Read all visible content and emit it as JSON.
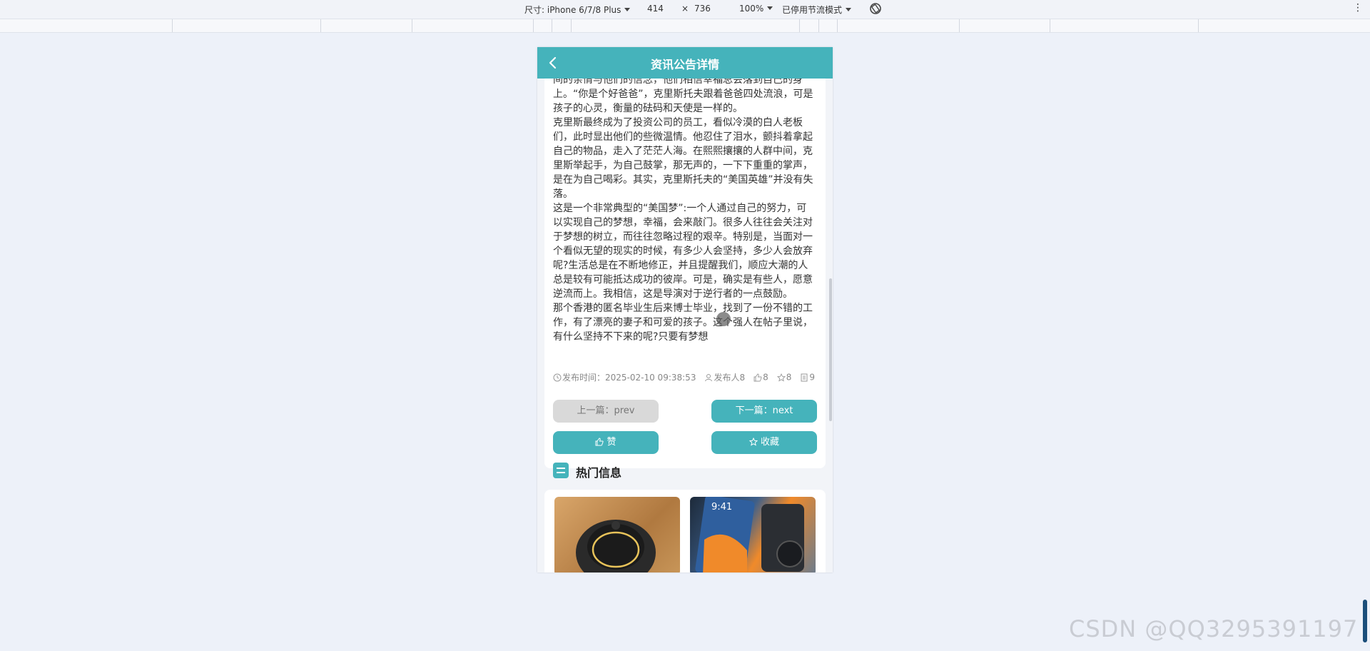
{
  "devtools": {
    "size_label": "尺寸: iPhone 6/7/8 Plus",
    "width": "414",
    "times": "×",
    "height": "736",
    "zoom": "100%",
    "throttle": "已停用节流模式",
    "more": "⋮"
  },
  "header": {
    "title": "资讯公告详情"
  },
  "article": {
    "paragraphs": [
      "间的亲情与他们的信念，他们相信幸福总会落到自己的身上。“你是个好爸爸”，克里斯托夫跟着爸爸四处流浪，可是孩子的心灵，衡量的砝码和天使是一样的。",
      "克里斯最终成为了投资公司的员工，看似冷漠的白人老板们，此时显出他们的些微温情。他忍住了泪水，颤抖着拿起自己的物品，走入了茫茫人海。在熙熙攘攘的人群中间，克里斯举起手，为自己鼓掌，那无声的，一下下重重的掌声，是在为自己喝彩。其实，克里斯托夫的“美国英雄”并没有失落。",
      "这是一个非常典型的“美国梦”:一个人通过自己的努力，可以实现自己的梦想，幸福，会来敲门。很多人往往会关注对于梦想的树立，而往往忽略过程的艰辛。特别是，当面对一个看似无望的现实的时候，有多少人会坚持，多少人会放弃呢?生活总是在不断地修正，并且提醒我们，顺应大潮的人总是较有可能抵达成功的彼岸。可是，确实是有些人，愿意逆流而上。我相信，这是导演对于逆行者的一点鼓励。",
      "那个香港的匿名毕业生后来博士毕业，找到了一份不错的工作，有了漂亮的妻子和可爱的孩子。这个强人在帖子里说，有什么坚持不下来的呢?只要有梦想"
    ],
    "meta": {
      "publish_time": "发布时间：2025-02-10 09:38:53",
      "publisher": "发布人8",
      "likes": "8",
      "favorites": "8",
      "views": "9"
    }
  },
  "buttons": {
    "prev": "上一篇：prev",
    "next": "下一篇：next",
    "like": "赞",
    "collect": "收藏"
  },
  "hot": {
    "title": "热门信息",
    "items": [
      {
        "img_icon": "speaker-image"
      },
      {
        "img_icon": "phone-holder-image",
        "overlay_text": "9:41"
      }
    ]
  },
  "watermark": "CSDN @QQ3295391197",
  "colors": {
    "primary": "#45b3bb",
    "disabled": "#d9d9d9",
    "background": "#edf1f9"
  }
}
